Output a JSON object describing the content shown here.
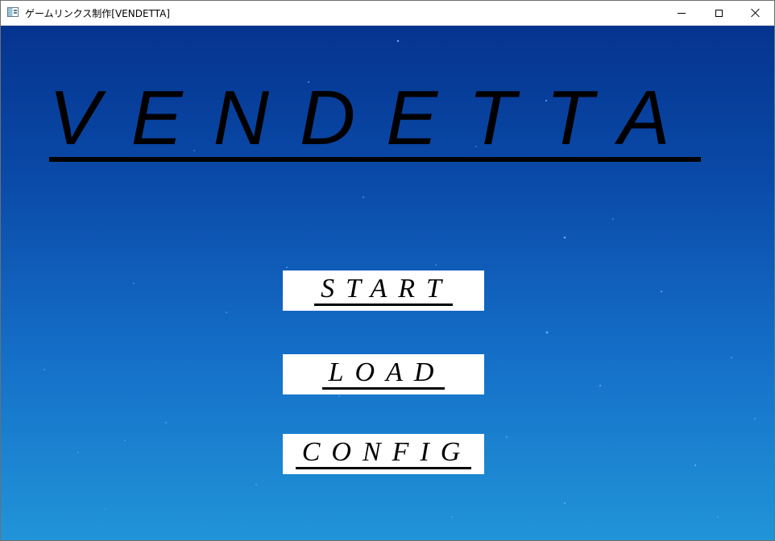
{
  "window": {
    "title": "ゲームリンクス制作[VENDETTA]",
    "app_icon": "app-window-icon",
    "controls": {
      "minimize_icon": "minimize-icon",
      "maximize_icon": "maximize-icon",
      "close_icon": "close-icon"
    }
  },
  "game": {
    "title": "VENDETTA",
    "background_colors": {
      "top": "#05348f",
      "bottom": "#2194d8"
    },
    "menu": {
      "start_label": "START",
      "load_label": "LOAD",
      "config_label": "CONFIG"
    }
  }
}
